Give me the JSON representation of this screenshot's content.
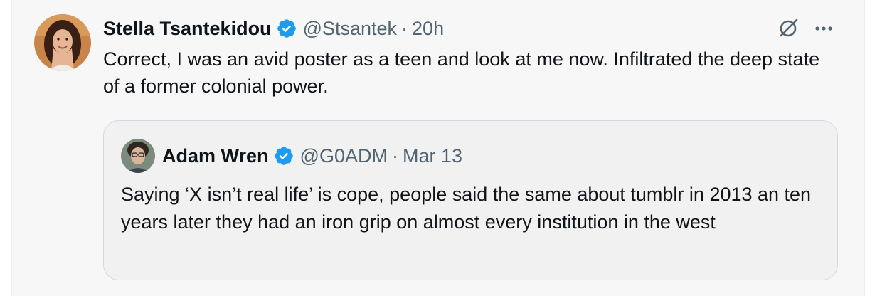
{
  "tweet": {
    "display_name": "Stella Tsantekidou",
    "handle": "@Stsantek",
    "separator": "·",
    "time": "20h",
    "text": "Correct, I was an avid poster as a teen and look at me now. Infiltrated the deep state of a former colonial power.",
    "verified": true,
    "avatar_icon": "profile-photo-woman",
    "actions": {
      "grok_icon": "grok-slash-circle-icon",
      "more_icon": "more-dots-icon"
    }
  },
  "quoted_tweet": {
    "display_name": "Adam Wren",
    "handle": "@G0ADM",
    "separator": "·",
    "time": "Mar 13",
    "text": "Saying ‘X isn’t real life’ is cope, people said the same about tumblr in 2013 an ten years later they had an iron grip on almost every institution in the west",
    "verified": true,
    "avatar_icon": "profile-photo-man"
  },
  "colors": {
    "verified_badge": "#1d9bf0",
    "primary_text": "#0f1419",
    "secondary_text": "#536471",
    "background": "#f7f7f7",
    "quote_border": "#cfd9de"
  }
}
